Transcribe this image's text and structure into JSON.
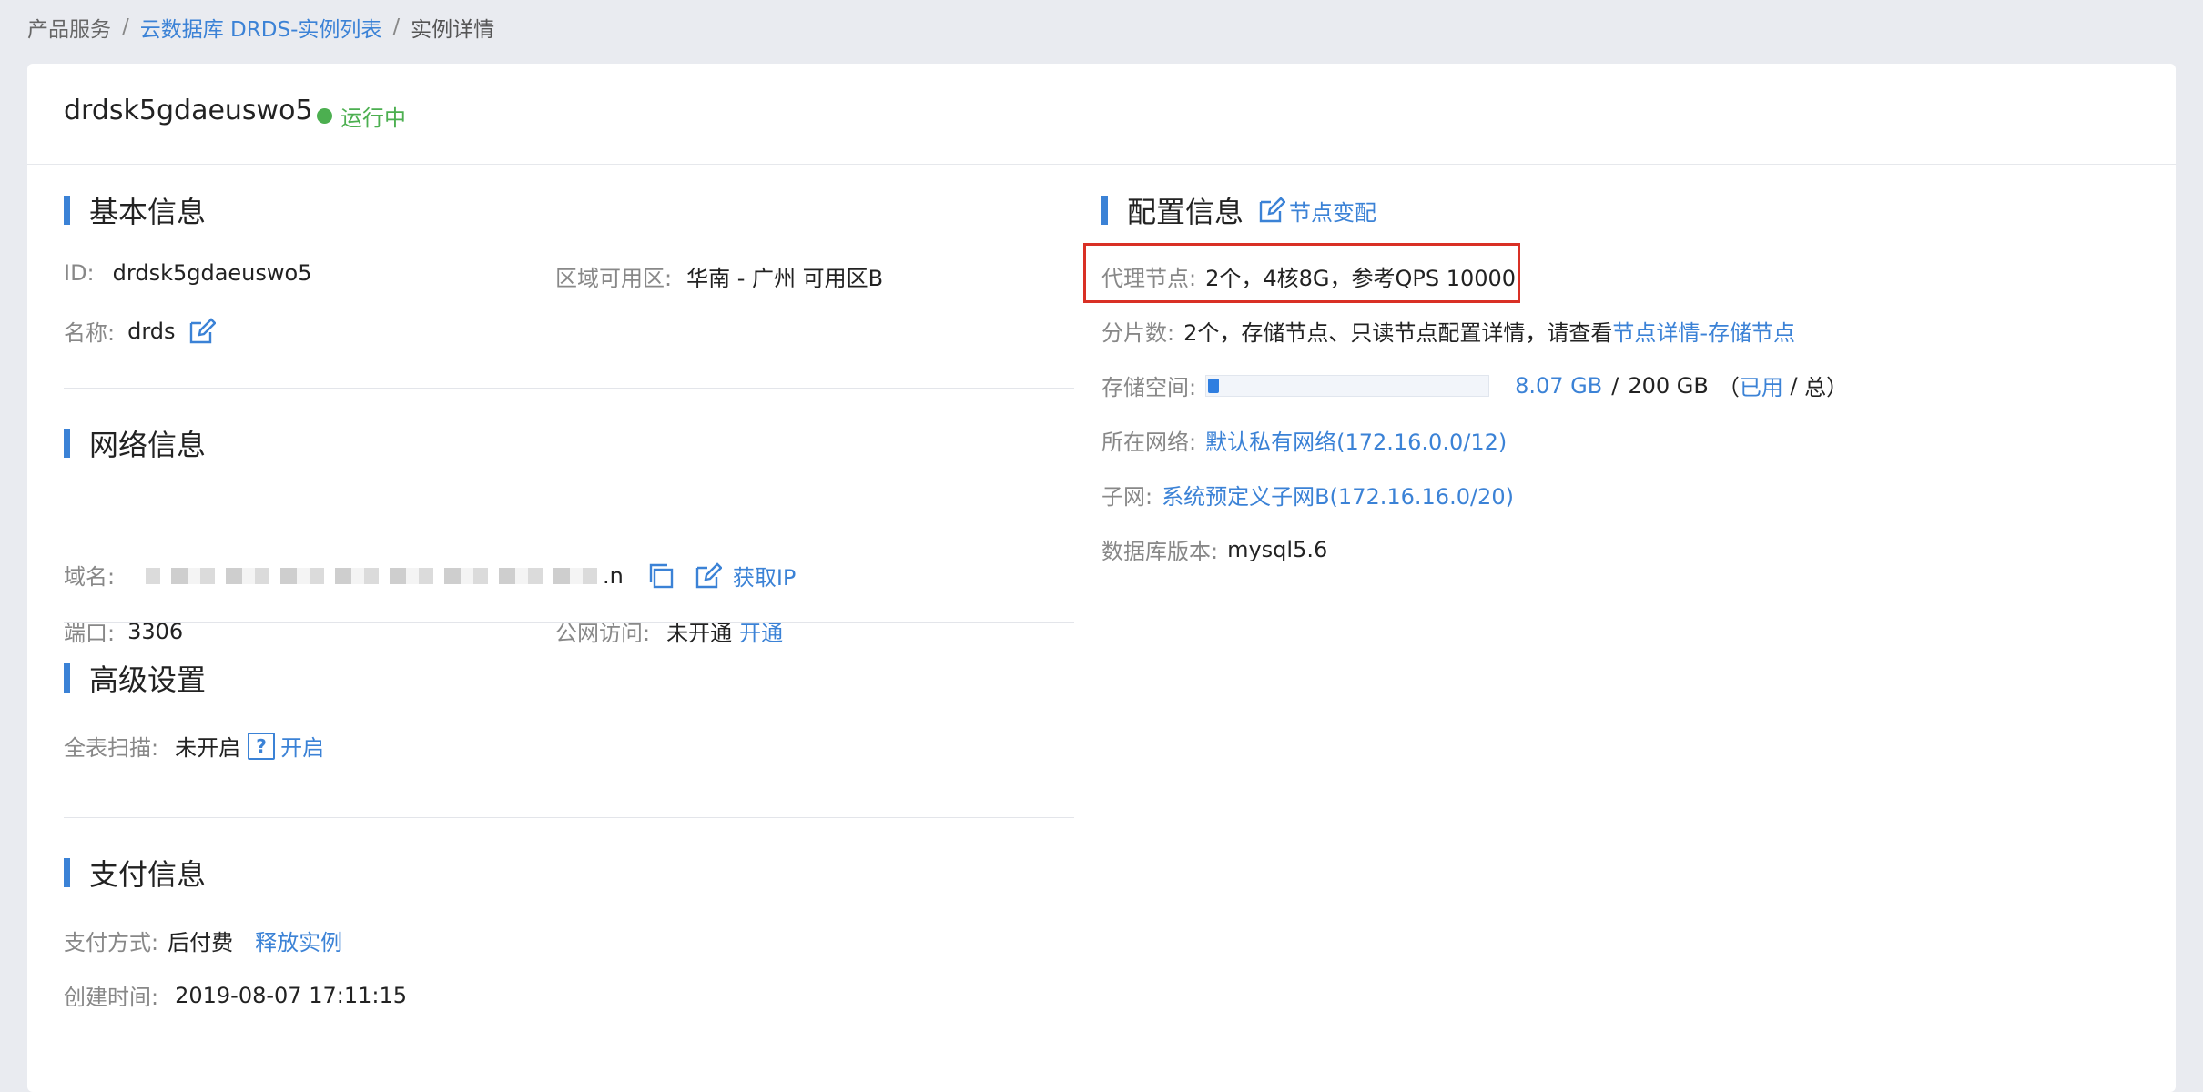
{
  "breadcrumb": {
    "item1": "产品服务",
    "sep": "/",
    "item2": "云数据库 DRDS-实例列表",
    "item3": "实例详情"
  },
  "instance": {
    "name": "drdsk5gdaeuswo5",
    "status": "运行中",
    "status_color": "#4caf50"
  },
  "basic": {
    "title": "基本信息",
    "id_label": "ID:",
    "id_value": "drdsk5gdaeuswo5",
    "zone_label": "区域可用区:",
    "zone_value": "华南 - 广州 可用区B",
    "name_label": "名称:",
    "name_value": "drds",
    "edit_icon": "edit-icon"
  },
  "network": {
    "title": "网络信息",
    "domain_label": "域名:",
    "domain_tail": ".n",
    "copy_icon": "copy-icon",
    "get_ip": "获取IP",
    "port_label": "端口:",
    "port_value": "3306",
    "public_label": "公网访问:",
    "public_value": "未开通",
    "public_action": "开通"
  },
  "advanced": {
    "title": "高级设置",
    "scan_label": "全表扫描:",
    "scan_value": "未开启",
    "help_glyph": "?",
    "scan_action": "开启"
  },
  "payment": {
    "title": "支付信息",
    "method_label": "支付方式:",
    "method_value": "后付费",
    "release_action": "释放实例",
    "created_label": "创建时间:",
    "created_value": "2019-08-07 17:11:15"
  },
  "config": {
    "title": "配置信息",
    "change_label": "节点变配",
    "proxy_label": "代理节点:",
    "proxy_value": "2个，4核8G，参考QPS 10000",
    "shard_label": "分片数:",
    "shard_value": "2个，存储节点、只读节点配置详情，请查看",
    "shard_link": "节点详情-存储节点",
    "storage_label": "存储空间:",
    "storage_used": "8.07 GB",
    "storage_sep": "/",
    "storage_total": "200 GB",
    "storage_legend_open": "（",
    "storage_legend_used": "已用",
    "storage_legend_sep": " / ",
    "storage_legend_total": "总）",
    "storage_fraction": 0.04,
    "network_label": "所在网络:",
    "network_value": "默认私有网络(172.16.0.0/12)",
    "subnet_label": "子网:",
    "subnet_value": "系统预定义子网B(172.16.16.0/20)",
    "db_version_label": "数据库版本:",
    "db_version_value": "mysql5.6"
  },
  "accent_color": "#3b82d6",
  "highlight_color": "#d93025"
}
